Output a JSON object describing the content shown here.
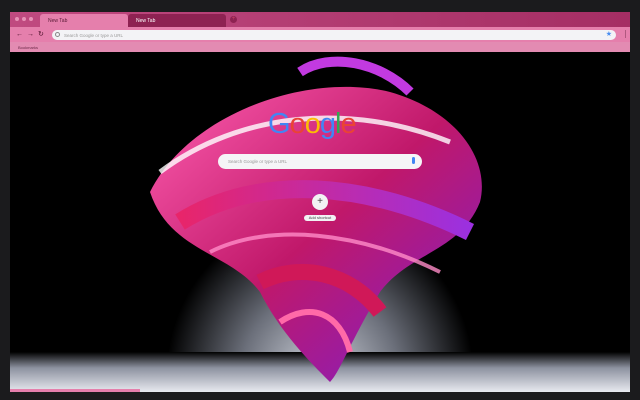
{
  "browser": {
    "tabs": [
      {
        "label": "New Tab",
        "active": true
      },
      {
        "label": "New Tab",
        "active": false
      }
    ],
    "new_tab_icon": "plus-icon",
    "omnibox": {
      "placeholder": "Search Google or type a URL"
    },
    "bookmarks_bar": {
      "label": "Bookmarks"
    },
    "colors": {
      "frame": "#a52e64",
      "toolbar": "#e57fac",
      "omnibox": "#f3f3f6"
    }
  },
  "ntp": {
    "logo": "Google",
    "search_placeholder": "Search Google or type a URL",
    "shortcut": {
      "icon": "plus-icon",
      "label": "Add shortcut"
    },
    "progress_percent": 21
  }
}
